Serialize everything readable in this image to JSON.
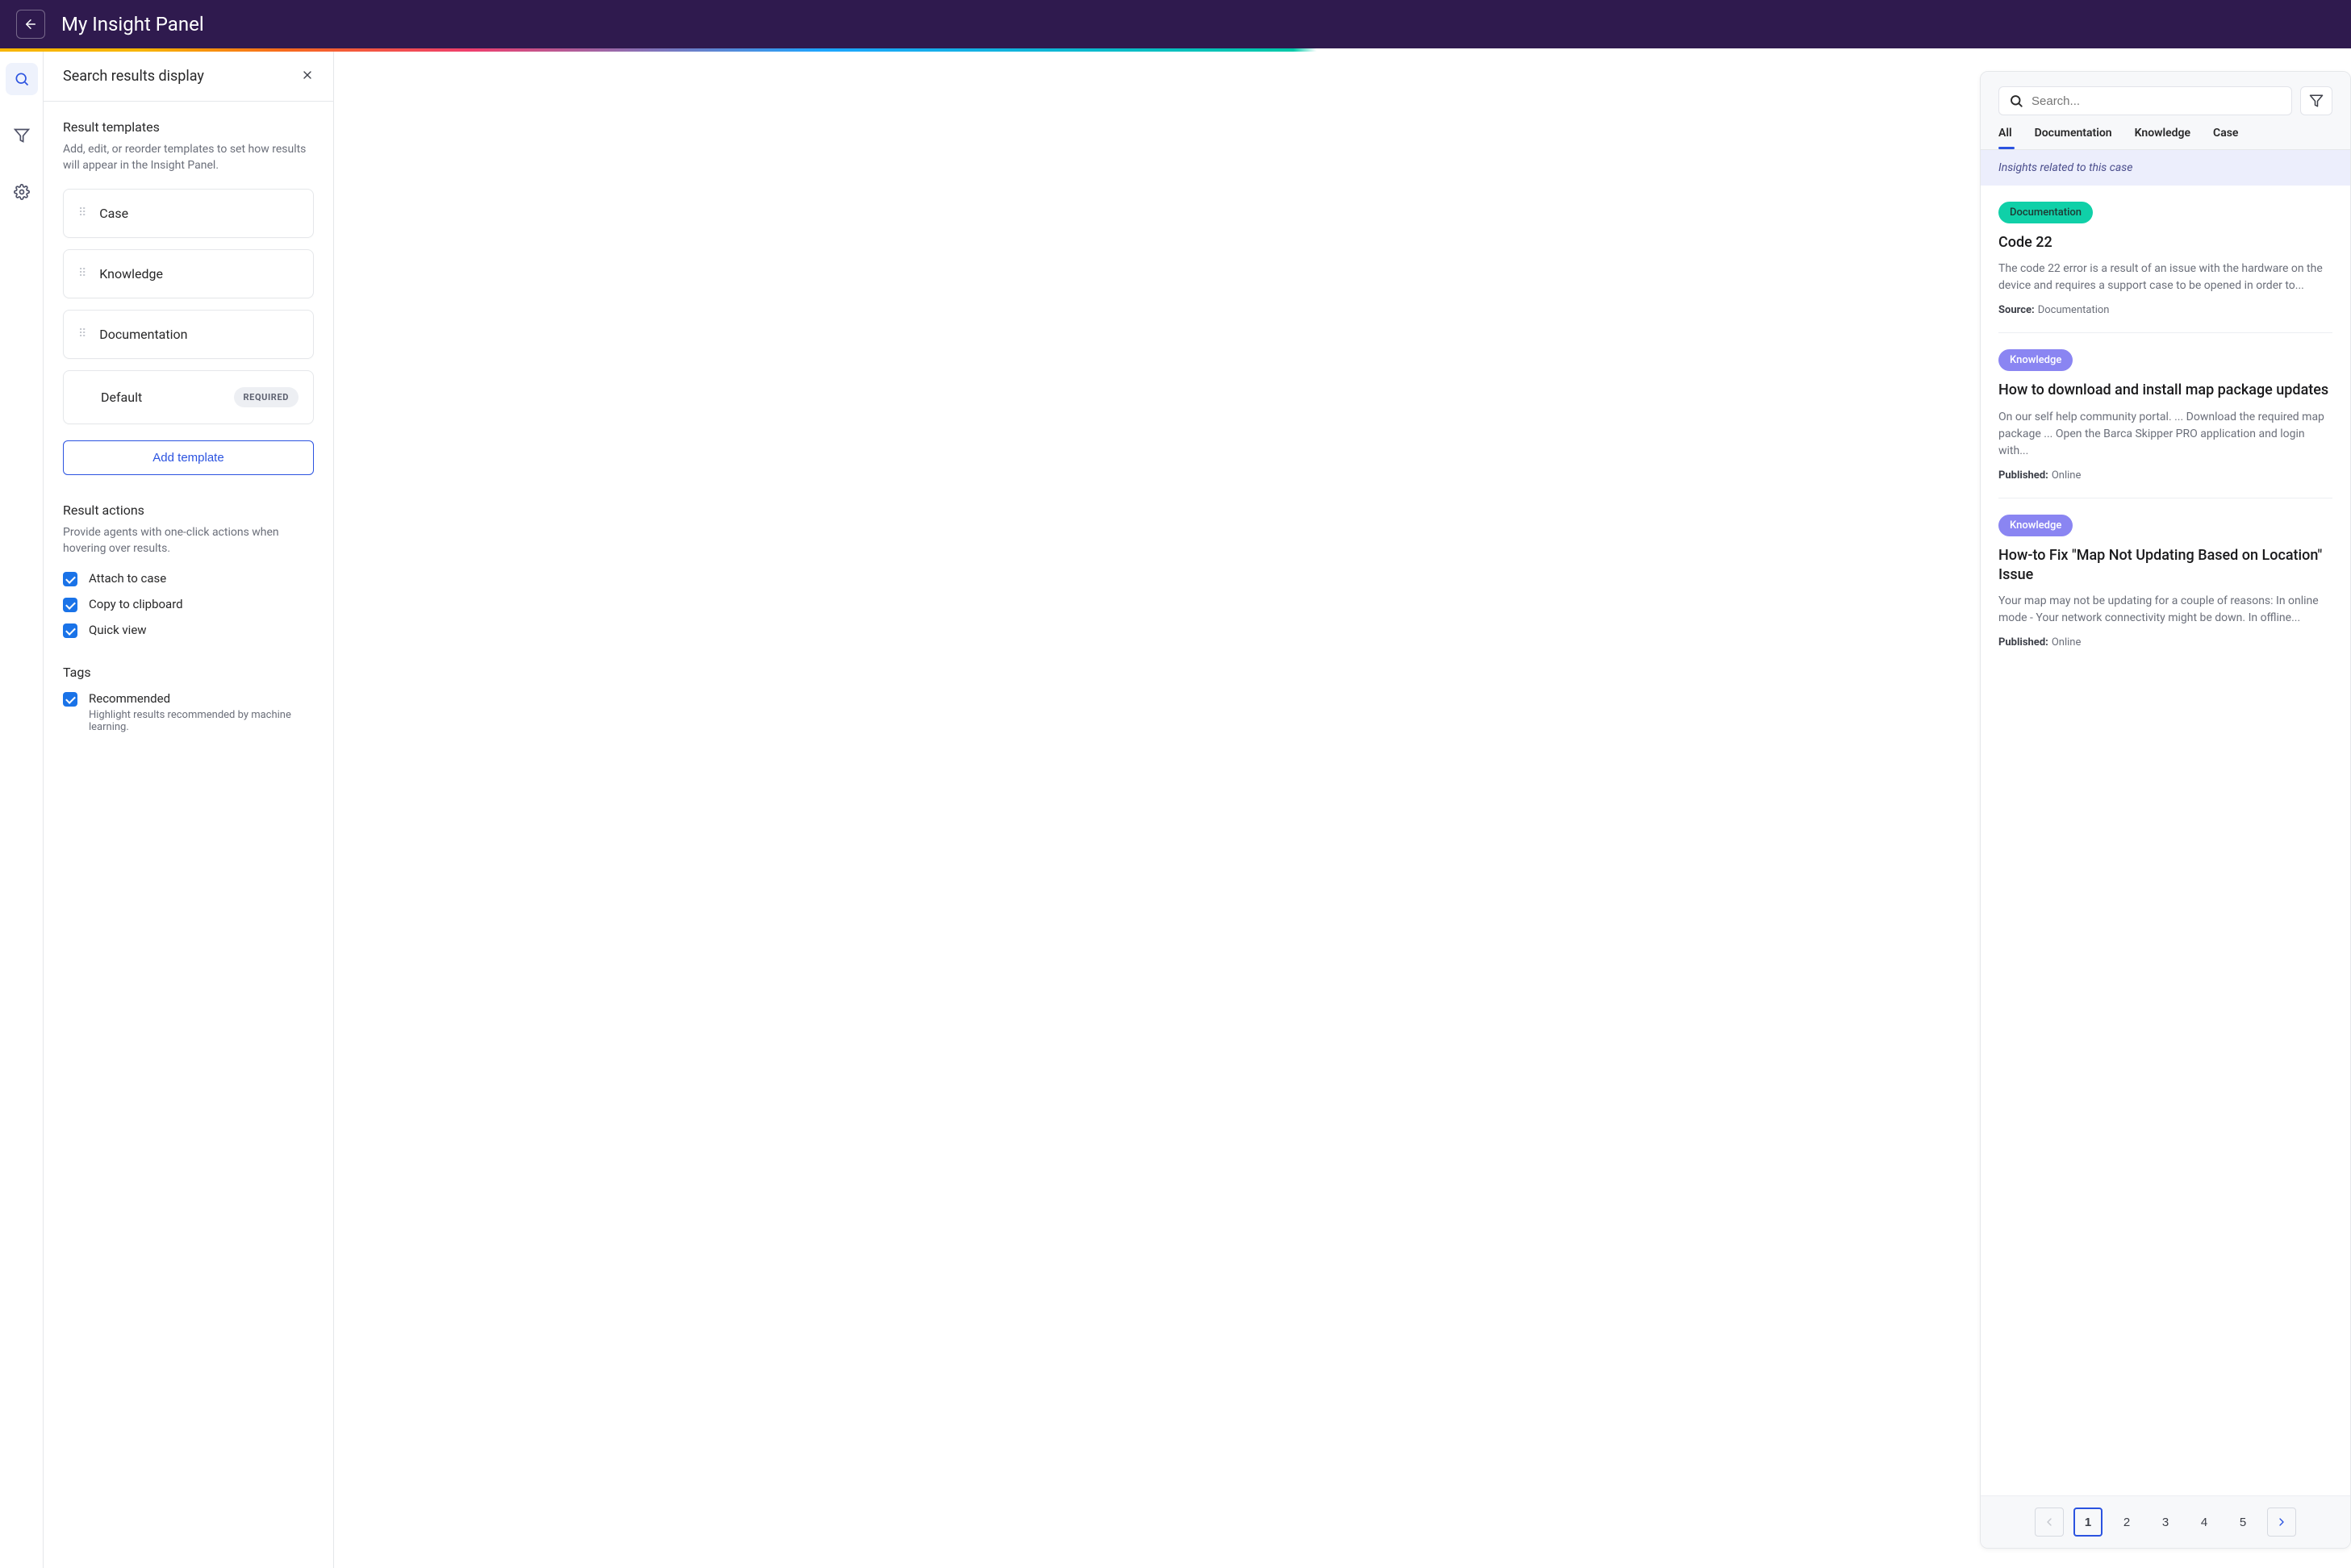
{
  "header": {
    "title": "My Insight Panel"
  },
  "panel": {
    "title": "Search results display",
    "templates_section": {
      "title": "Result templates",
      "desc": "Add, edit, or reorder templates to set how results will appear in the Insight Panel.",
      "items": [
        "Case",
        "Knowledge",
        "Documentation",
        "Default"
      ],
      "required_label": "REQUIRED",
      "add_btn": "Add template"
    },
    "actions_section": {
      "title": "Result actions",
      "desc": "Provide agents with one-click actions when hovering over results.",
      "items": [
        "Attach to case",
        "Copy to clipboard",
        "Quick view"
      ]
    },
    "tags_section": {
      "title": "Tags",
      "item": "Recommended",
      "sub": "Highlight results recommended by machine learning."
    }
  },
  "preview": {
    "search_placeholder": "Search...",
    "tabs": [
      "All",
      "Documentation",
      "Knowledge",
      "Case"
    ],
    "banner": "Insights related to this case",
    "results": [
      {
        "badge": "Documentation",
        "badgeClass": "doc",
        "title": "Code 22",
        "snippet": "The code 22 error is a result of an issue with the hardware on the device and requires a support case to be opened in order to...",
        "metaKey": "Source:",
        "metaVal": "Documentation"
      },
      {
        "badge": "Knowledge",
        "badgeClass": "know",
        "title": "How to download and install map package updates",
        "snippet": "On our self help community portal. ... Download the required map package ... Open the Barca Skipper PRO application and login with...",
        "metaKey": "Published:",
        "metaVal": "Online"
      },
      {
        "badge": "Knowledge",
        "badgeClass": "know",
        "title": "How-to Fix \"Map Not Updating Based on Location\" Issue",
        "snippet": "Your map may not be updating for a couple of reasons: In online mode - Your network connectivity might be down. In offline...",
        "metaKey": "Published:",
        "metaVal": "Online"
      }
    ],
    "pages": [
      "1",
      "2",
      "3",
      "4",
      "5"
    ]
  }
}
